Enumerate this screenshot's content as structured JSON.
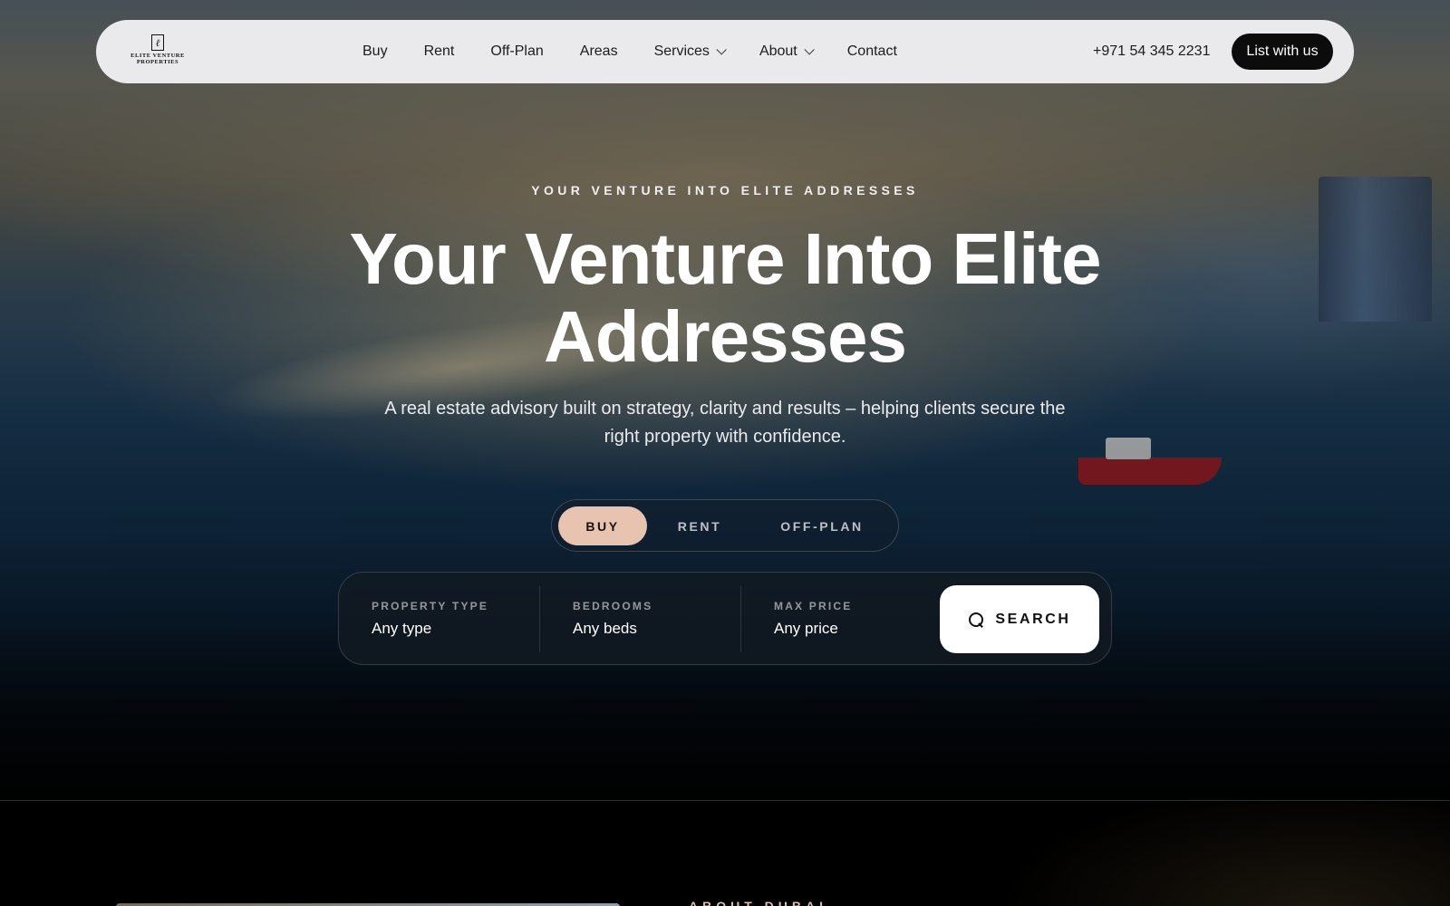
{
  "nav": {
    "logo": {
      "mark": "ℓ",
      "line1": "ELITE VENTURE",
      "line2": "PROPERTIES"
    },
    "links": [
      {
        "label": "Buy"
      },
      {
        "label": "Rent"
      },
      {
        "label": "Off-Plan"
      },
      {
        "label": "Areas"
      },
      {
        "label": "Services",
        "dropdown": true
      },
      {
        "label": "About",
        "dropdown": true
      },
      {
        "label": "Contact"
      }
    ],
    "phone": "+971 54 345 2231",
    "cta": "List with us"
  },
  "hero": {
    "eyebrow": "YOUR VENTURE INTO ELITE ADDRESSES",
    "headline": "Your Venture Into Elite Addresses",
    "subline": "A real estate advisory built on strategy, clarity and results – helping clients secure the right property with confidence."
  },
  "tabs": [
    {
      "label": "BUY",
      "active": true
    },
    {
      "label": "RENT",
      "active": false
    },
    {
      "label": "OFF-PLAN",
      "active": false
    }
  ],
  "search": {
    "fields": [
      {
        "label": "PROPERTY TYPE",
        "value": "Any type"
      },
      {
        "label": "BEDROOMS",
        "value": "Any beds"
      },
      {
        "label": "MAX PRICE",
        "value": "Any price"
      }
    ],
    "button": "SEARCH"
  },
  "about": {
    "eyebrow": "ABOUT DUBAI"
  },
  "colors": {
    "accent": "#e7c3b0",
    "nav_bg": "#f0f0f2",
    "cta_bg": "#0c0c0c"
  }
}
